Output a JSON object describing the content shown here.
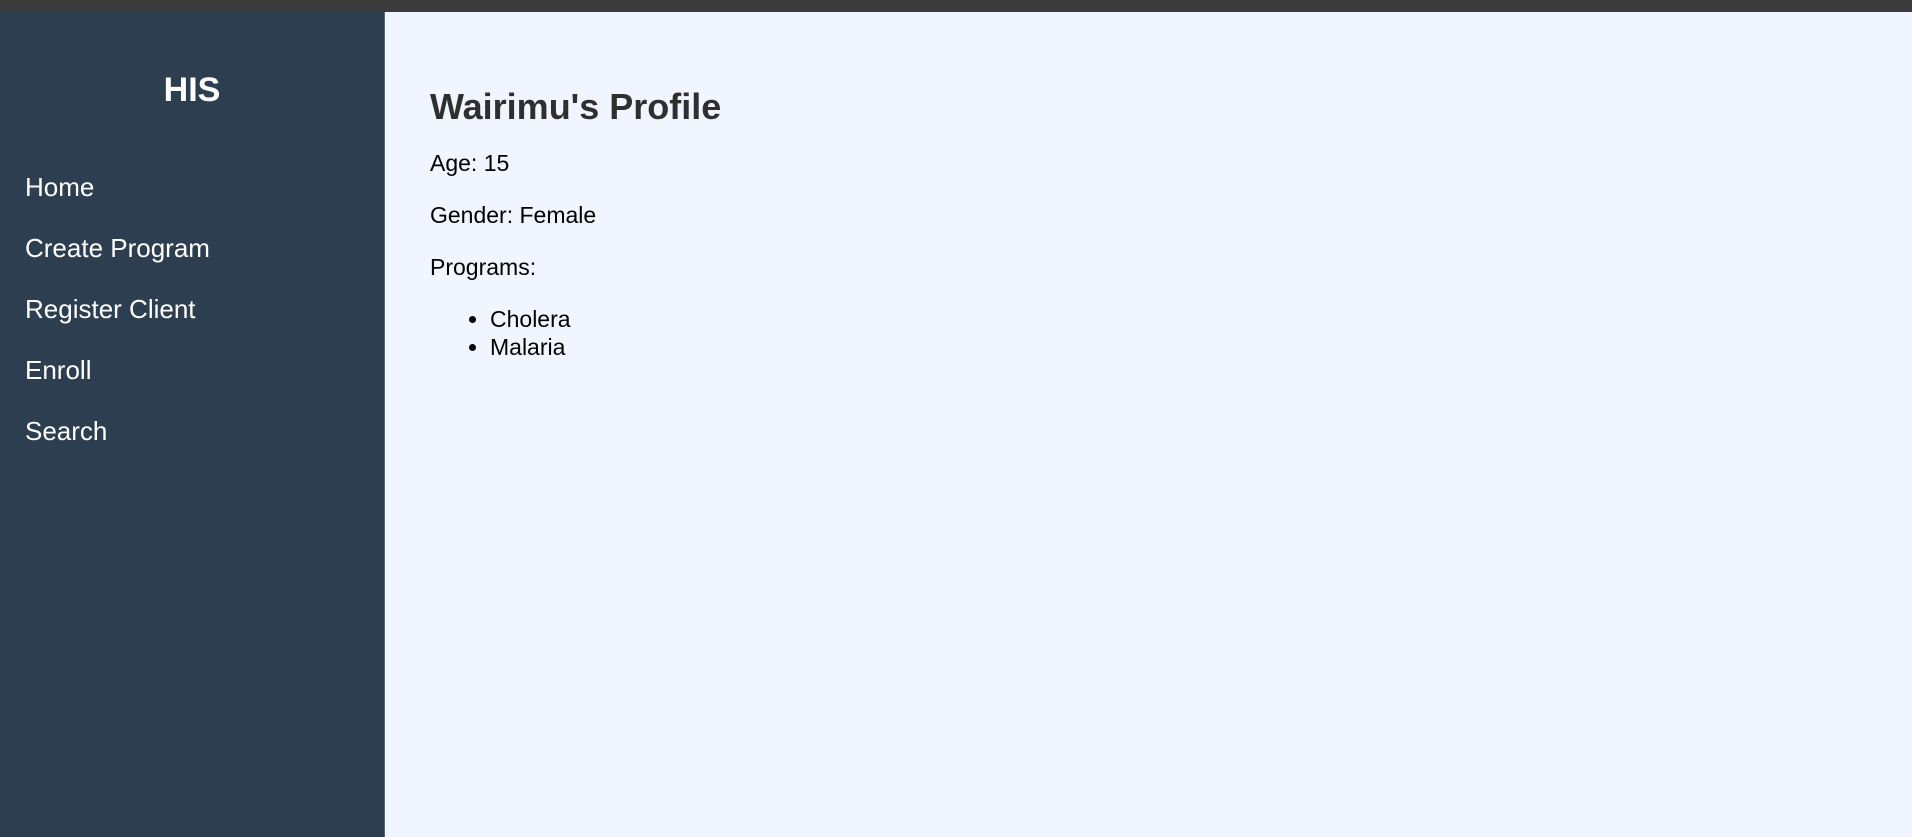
{
  "app": {
    "brand": "HIS"
  },
  "sidebar": {
    "items": [
      {
        "label": "Home"
      },
      {
        "label": "Create Program"
      },
      {
        "label": "Register Client"
      },
      {
        "label": "Enroll"
      },
      {
        "label": "Search"
      }
    ]
  },
  "profile": {
    "title": "Wairimu's Profile",
    "age_text": "Age: 15",
    "gender_text": "Gender: Female",
    "programs_label": "Programs:",
    "programs": [
      {
        "name": "Cholera"
      },
      {
        "name": "Malaria"
      }
    ]
  },
  "colors": {
    "sidebar_background": "#2c3e50",
    "main_background": "#f0f5ff",
    "title_text": "#2f2f2f"
  },
  "icons": [
    {
      "name": "bullet-icon"
    }
  ]
}
